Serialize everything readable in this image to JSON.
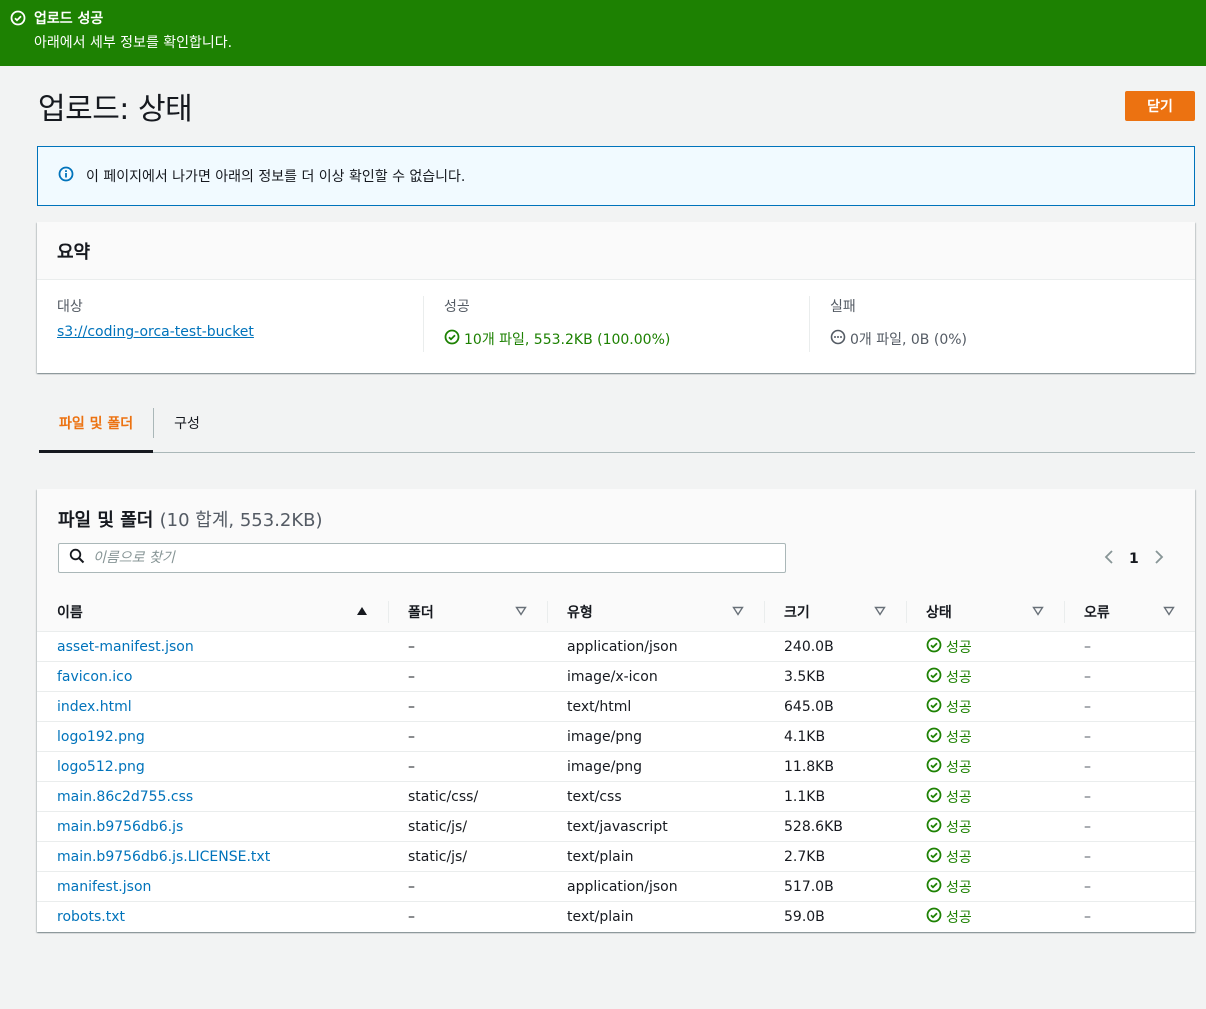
{
  "flash": {
    "title": "업로드 성공",
    "message": "아래에서 세부 정보를 확인합니다.",
    "color": "#1d8102"
  },
  "page": {
    "title": "업로드: 상태",
    "close_label": "닫기"
  },
  "info": {
    "message": "이 페이지에서 나가면 아래의 정보를 더 이상 확인할 수 없습니다."
  },
  "summary": {
    "heading": "요약",
    "destination_label": "대상",
    "destination_value": "s3://coding-orca-test-bucket",
    "success_label": "성공",
    "success_value": "10개 파일, 553.2KB (100.00%)",
    "failed_label": "실패",
    "failed_value": "0개 파일, 0B (0%)"
  },
  "tabs": [
    {
      "label": "파일 및 폴더",
      "active": true
    },
    {
      "label": "구성",
      "active": false
    }
  ],
  "files": {
    "heading": "파일 및 폴더",
    "count": "(10 합계, 553.2KB)",
    "search_placeholder": "이름으로 찾기",
    "page": "1",
    "columns": [
      "이름",
      "폴더",
      "유형",
      "크기",
      "상태",
      "오류"
    ],
    "rows": [
      {
        "name": "asset-manifest.json",
        "folder": "–",
        "type": "application/json",
        "size": "240.0B",
        "status": "성공",
        "error": "–"
      },
      {
        "name": "favicon.ico",
        "folder": "–",
        "type": "image/x-icon",
        "size": "3.5KB",
        "status": "성공",
        "error": "–"
      },
      {
        "name": "index.html",
        "folder": "–",
        "type": "text/html",
        "size": "645.0B",
        "status": "성공",
        "error": "–"
      },
      {
        "name": "logo192.png",
        "folder": "–",
        "type": "image/png",
        "size": "4.1KB",
        "status": "성공",
        "error": "–"
      },
      {
        "name": "logo512.png",
        "folder": "–",
        "type": "image/png",
        "size": "11.8KB",
        "status": "성공",
        "error": "–"
      },
      {
        "name": "main.86c2d755.css",
        "folder": "static/css/",
        "type": "text/css",
        "size": "1.1KB",
        "status": "성공",
        "error": "–"
      },
      {
        "name": "main.b9756db6.js",
        "folder": "static/js/",
        "type": "text/javascript",
        "size": "528.6KB",
        "status": "성공",
        "error": "–"
      },
      {
        "name": "main.b9756db6.js.LICENSE.txt",
        "folder": "static/js/",
        "type": "text/plain",
        "size": "2.7KB",
        "status": "성공",
        "error": "–"
      },
      {
        "name": "manifest.json",
        "folder": "–",
        "type": "application/json",
        "size": "517.0B",
        "status": "성공",
        "error": "–"
      },
      {
        "name": "robots.txt",
        "folder": "–",
        "type": "text/plain",
        "size": "59.0B",
        "status": "성공",
        "error": "–"
      }
    ]
  },
  "colors": {
    "accent": "#ec7211",
    "link": "#0073bb",
    "success": "#1d8102"
  }
}
